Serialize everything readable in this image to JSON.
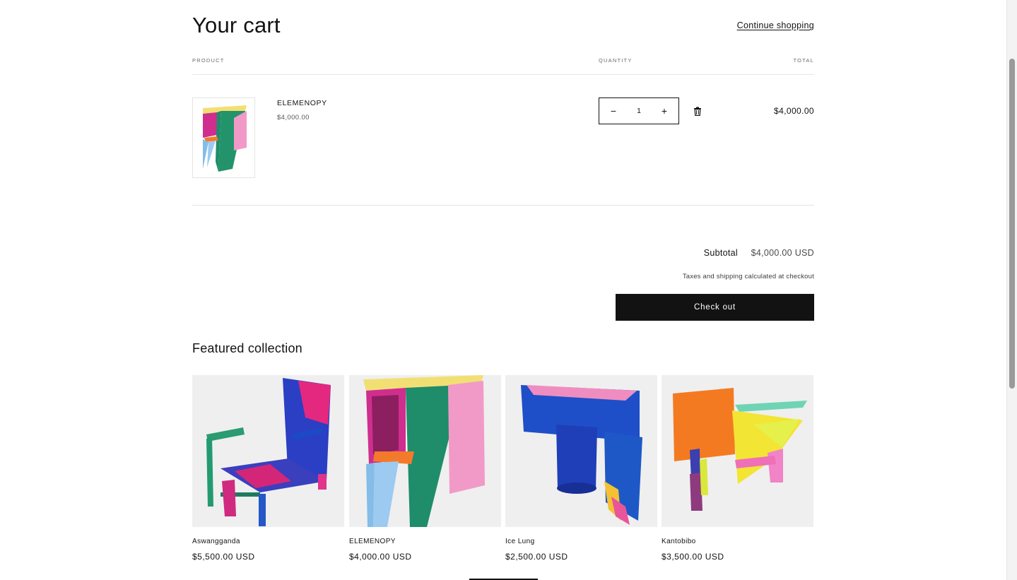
{
  "cart": {
    "title": "Your cart",
    "continue_label": "Continue shopping",
    "columns": {
      "product": "PRODUCT",
      "quantity": "QUANTITY",
      "total": "TOTAL"
    },
    "item": {
      "name": "ELEMENOPY",
      "price": "$4,000.00",
      "quantity": "1",
      "decrease_label": "−",
      "increase_label": "+",
      "line_total": "$4,000.00",
      "remove_icon": "trash-icon"
    }
  },
  "summary": {
    "subtotal_label": "Subtotal",
    "subtotal_value": "$4,000.00 USD",
    "tax_note": "Taxes and shipping calculated at checkout",
    "checkout_label": "Check out"
  },
  "featured": {
    "title": "Featured collection",
    "products": [
      {
        "name": "Aswangganda",
        "price": "$5,500.00 USD"
      },
      {
        "name": "ELEMENOPY",
        "price": "$4,000.00 USD"
      },
      {
        "name": "Ice Lung",
        "price": "$2,500.00 USD"
      },
      {
        "name": "Kantobibo",
        "price": "$3,500.00 USD"
      }
    ]
  },
  "colors": {
    "button_bg": "#121212",
    "card_bg": "#efefef",
    "divider": "#e5e5e5"
  }
}
